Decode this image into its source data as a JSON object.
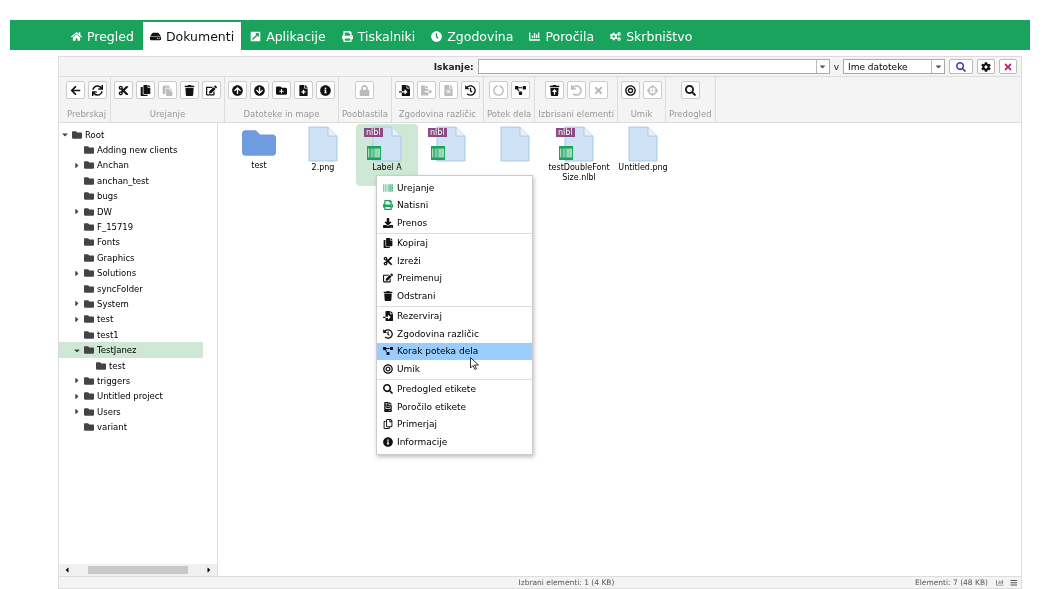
{
  "nav": {
    "tabs": [
      {
        "label": "Pregled",
        "selected": false
      },
      {
        "label": "Dokumenti",
        "selected": true
      },
      {
        "label": "Aplikacije",
        "selected": false
      },
      {
        "label": "Tiskalniki",
        "selected": false
      },
      {
        "label": "Zgodovina",
        "selected": false
      },
      {
        "label": "Poročila",
        "selected": false
      },
      {
        "label": "Skrbništvo",
        "selected": false
      }
    ]
  },
  "search": {
    "label": "Iskanje:",
    "connector": "v",
    "scope": "Ime datoteke"
  },
  "toolbar": [
    {
      "label": "Prebrskaj",
      "buttons": [
        {
          "disabled": false
        },
        {
          "disabled": false
        }
      ]
    },
    {
      "label": "Urejanje",
      "buttons": [
        {
          "disabled": false
        },
        {
          "disabled": false
        },
        {
          "disabled": true
        },
        {
          "disabled": false
        },
        {
          "disabled": false
        }
      ]
    },
    {
      "label": "Datoteke in mape",
      "buttons": [
        {
          "disabled": false
        },
        {
          "disabled": false
        },
        {
          "disabled": false
        },
        {
          "disabled": false
        },
        {
          "disabled": false
        }
      ]
    },
    {
      "label": "Pooblastila",
      "buttons": [
        {
          "disabled": true
        }
      ]
    },
    {
      "label": "Zgodovina različic",
      "buttons": [
        {
          "disabled": false
        },
        {
          "disabled": true
        },
        {
          "disabled": true
        },
        {
          "disabled": false
        }
      ]
    },
    {
      "label": "Potek dela",
      "buttons": [
        {
          "disabled": true
        },
        {
          "disabled": false
        }
      ]
    },
    {
      "label": "Izbrisani elementi",
      "buttons": [
        {
          "disabled": false
        },
        {
          "disabled": true
        },
        {
          "disabled": true
        }
      ]
    },
    {
      "label": "Umik",
      "buttons": [
        {
          "disabled": false
        },
        {
          "disabled": true
        }
      ]
    },
    {
      "label": "Predogled",
      "buttons": [
        {
          "disabled": false
        }
      ]
    }
  ],
  "tree": [
    {
      "label": "Root",
      "expanded": true,
      "selected": false,
      "children": [
        {
          "label": "Adding new clients",
          "selected": false
        },
        {
          "label": "Anchan",
          "expanded": false,
          "selected": false
        },
        {
          "label": "anchan_test",
          "selected": false
        },
        {
          "label": "bugs",
          "selected": false
        },
        {
          "label": "DW",
          "expanded": false,
          "selected": false
        },
        {
          "label": "F_15719",
          "selected": false
        },
        {
          "label": "Fonts",
          "selected": false
        },
        {
          "label": "Graphics",
          "selected": false
        },
        {
          "label": "Solutions",
          "expanded": false,
          "selected": false
        },
        {
          "label": "syncFolder",
          "selected": false
        },
        {
          "label": "System",
          "expanded": false,
          "selected": false
        },
        {
          "label": "test",
          "expanded": false,
          "selected": false
        },
        {
          "label": "test1",
          "selected": false
        },
        {
          "label": "TestJanez",
          "expanded": true,
          "selected": true,
          "children": [
            {
              "label": "test",
              "selected": false
            }
          ]
        },
        {
          "label": "triggers",
          "expanded": false,
          "selected": false
        },
        {
          "label": "Untitled project",
          "expanded": false,
          "selected": false
        },
        {
          "label": "Users",
          "expanded": false,
          "selected": false
        },
        {
          "label": "variant",
          "selected": false
        }
      ]
    }
  ],
  "files": [
    {
      "kind": "folder",
      "name": "test",
      "selected": false
    },
    {
      "kind": "file",
      "name": "2.png",
      "selected": false
    },
    {
      "kind": "label",
      "badge": "nlbl",
      "name": "Label A",
      "selected": true
    },
    {
      "kind": "label",
      "badge": "nlbl",
      "selected": false
    },
    {
      "kind": "file",
      "selected": false
    },
    {
      "kind": "label",
      "badge": "nlbl",
      "name": "testDoubleFontSize.nlbl",
      "selected": false
    },
    {
      "kind": "file",
      "name": "Untitled.png",
      "selected": false
    }
  ],
  "context_menu": [
    [
      {
        "label": "Urejanje",
        "selected": false
      },
      {
        "label": "Natisni",
        "selected": false
      },
      {
        "label": "Prenos",
        "selected": false
      }
    ],
    [
      {
        "label": "Kopiraj",
        "selected": false
      },
      {
        "label": "Izreži",
        "selected": false
      },
      {
        "label": "Preimenuj",
        "selected": false
      },
      {
        "label": "Odstrani",
        "selected": false
      }
    ],
    [
      {
        "label": "Rezerviraj",
        "selected": false
      },
      {
        "label": "Zgodovina različic",
        "selected": false
      },
      {
        "label": "Korak poteka dela",
        "selected": true
      },
      {
        "label": "Umik",
        "selected": false
      }
    ],
    [
      {
        "label": "Predogled etikete",
        "selected": false
      },
      {
        "label": "Poročilo etikete",
        "selected": false
      },
      {
        "label": "Primerjaj",
        "selected": false
      },
      {
        "label": "Informacije",
        "selected": false
      }
    ]
  ],
  "status": {
    "selection": "Izbrani elementi: 1 (4 KB)",
    "count": "Elementi: 7 (48 KB)"
  }
}
